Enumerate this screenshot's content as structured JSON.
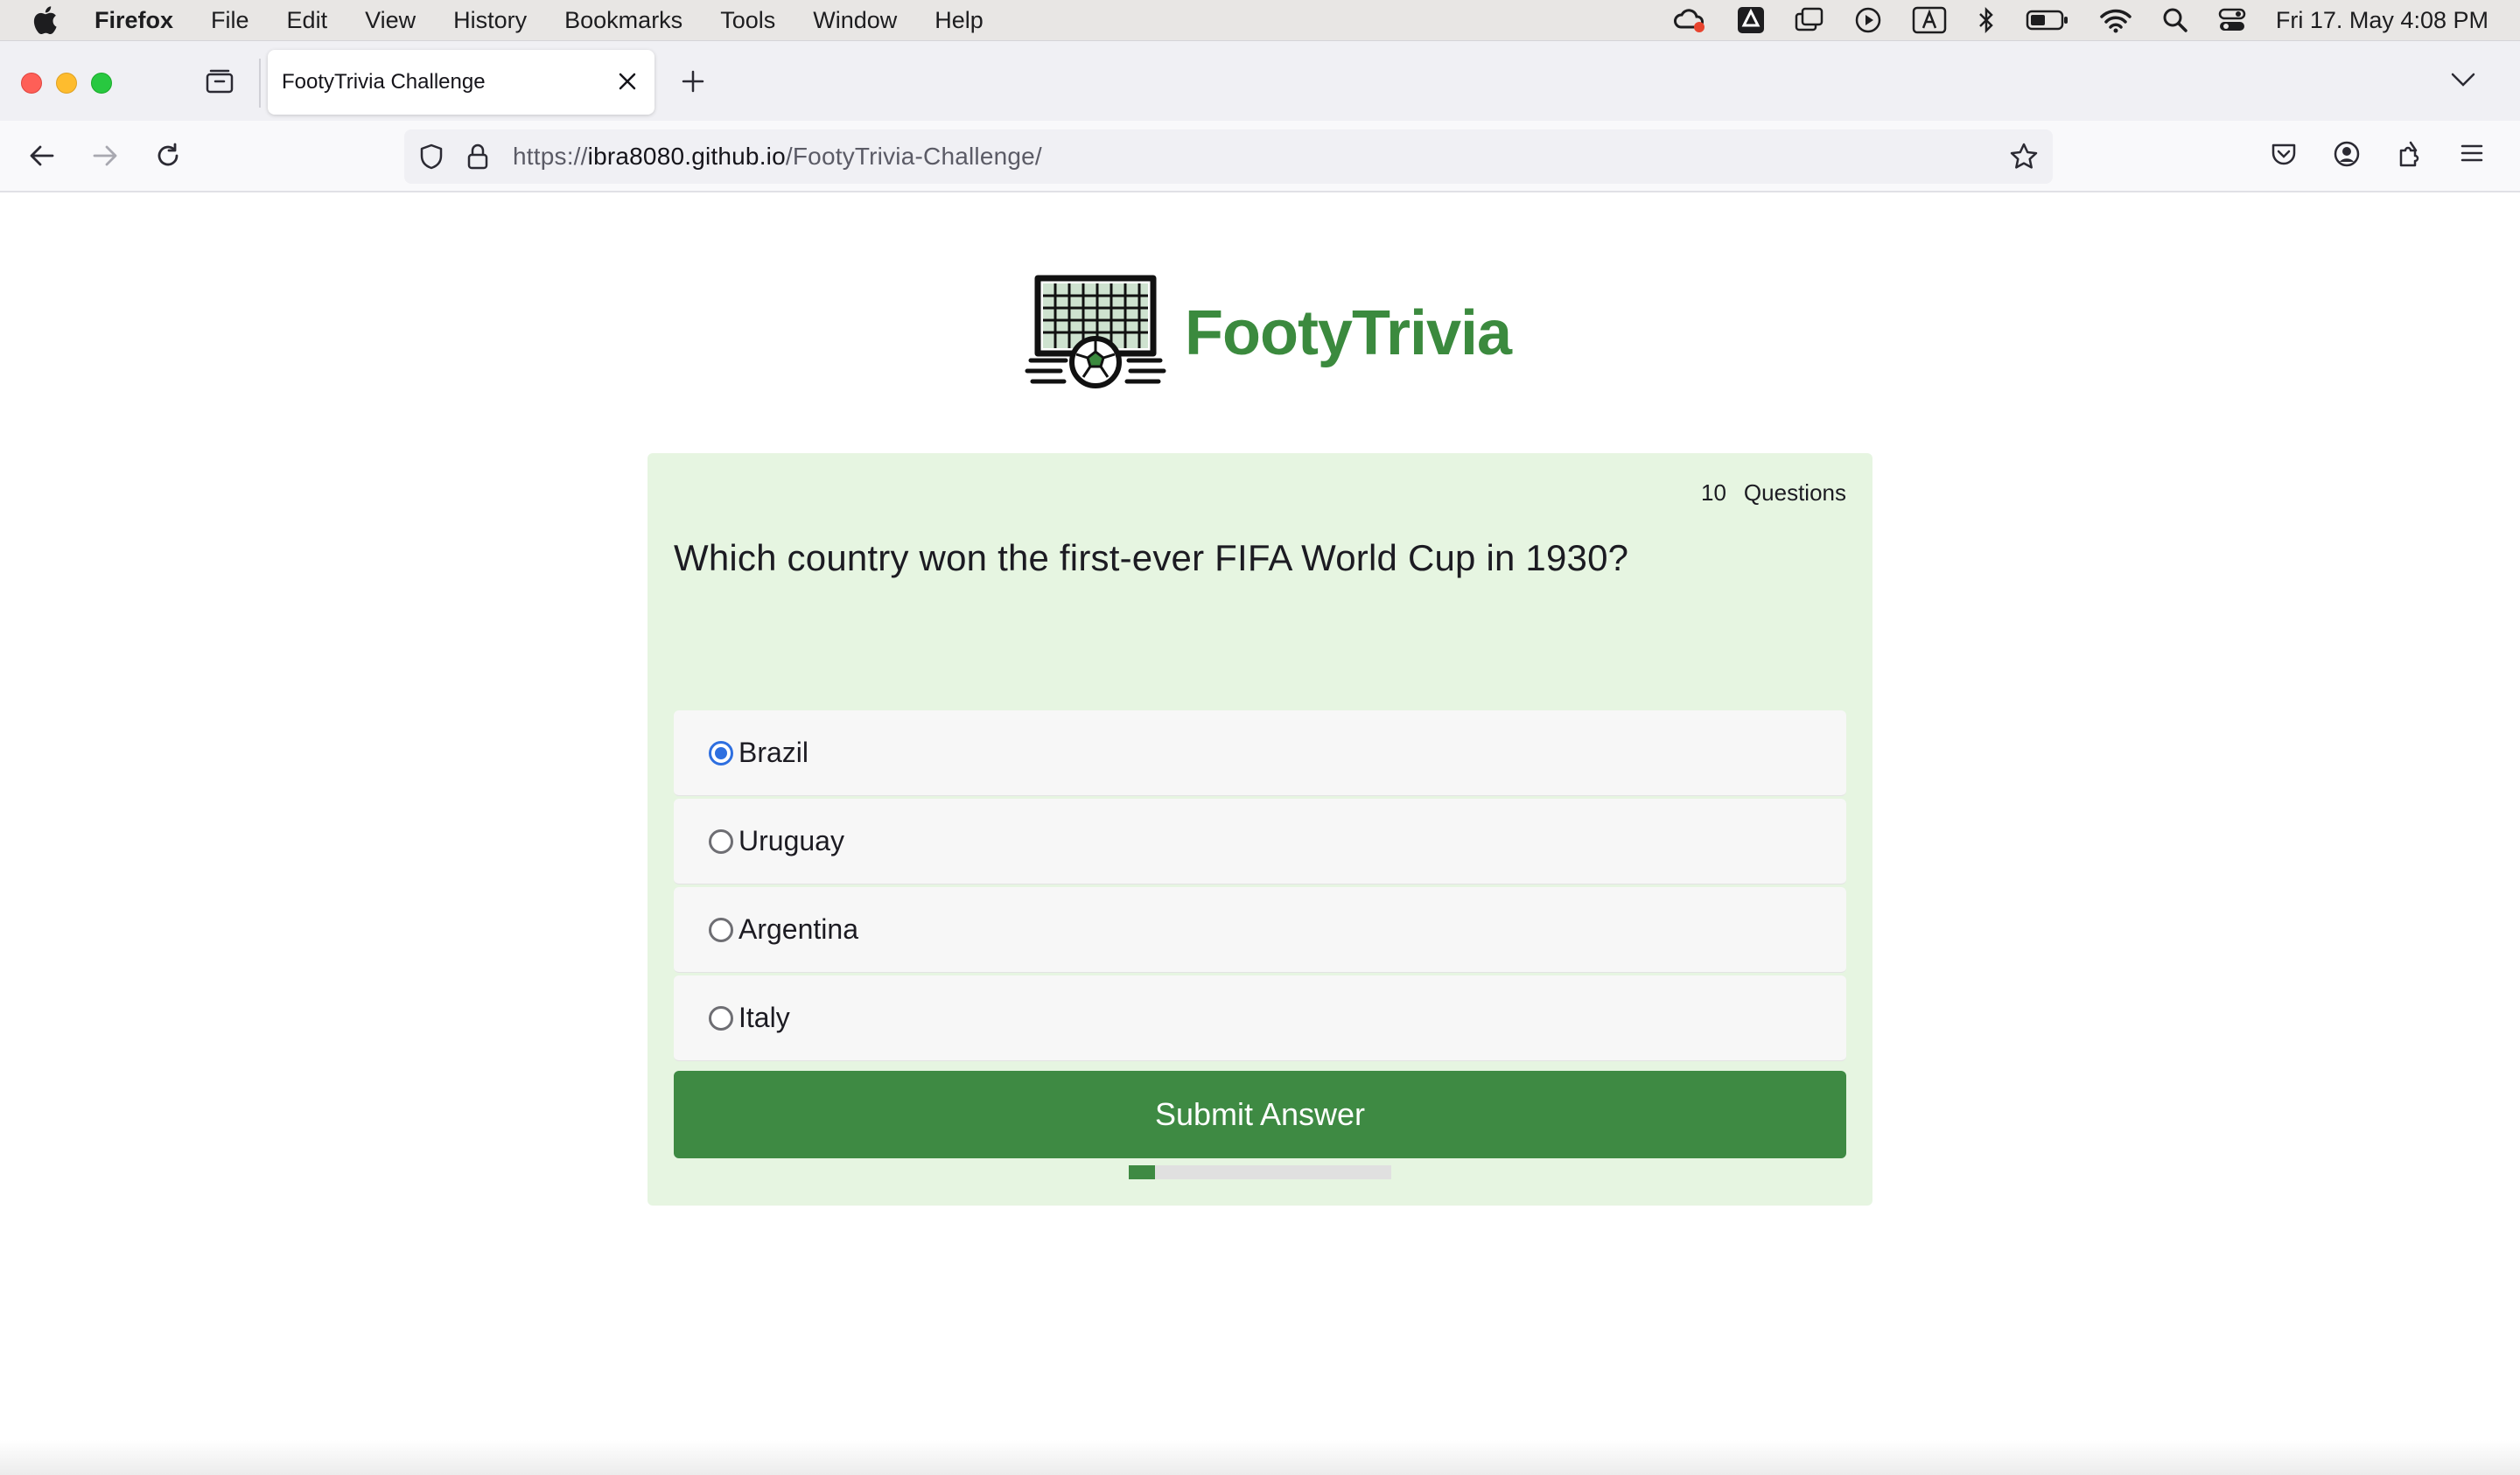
{
  "menubar": {
    "app_name": "Firefox",
    "items": [
      "File",
      "Edit",
      "View",
      "History",
      "Bookmarks",
      "Tools",
      "Window",
      "Help"
    ],
    "clock": "Fri 17. May  4:08 PM"
  },
  "browser": {
    "tab_title": "FootyTrivia Challenge",
    "url_scheme": "https://",
    "url_host": "ibra8080.github.io",
    "url_path": "/FootyTrivia-Challenge/"
  },
  "page": {
    "brand": "FootyTrivia",
    "question_count": "10",
    "question_count_label": "Questions",
    "question": "Which country won the first-ever FIFA World Cup in 1930?",
    "options": [
      {
        "label": "Brazil",
        "checked": true
      },
      {
        "label": "Uruguay",
        "checked": false
      },
      {
        "label": "Argentina",
        "checked": false
      },
      {
        "label": "Italy",
        "checked": false
      }
    ],
    "submit_label": "Submit Answer",
    "progress_fraction": 0.1
  },
  "colors": {
    "brand_green": "#3b8a3e",
    "card_bg": "#e6f5e1",
    "button_green": "#3e8a43",
    "radio_blue": "#2e6fe0"
  }
}
